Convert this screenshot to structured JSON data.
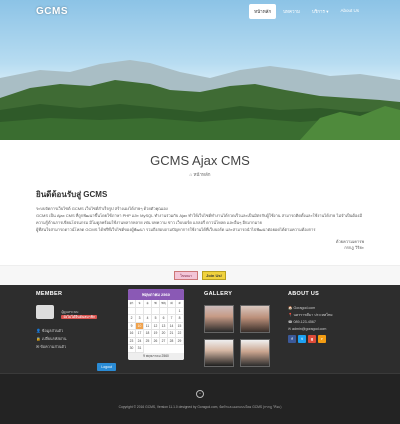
{
  "header": {
    "logo": "GCMS",
    "nav": [
      {
        "label": "หน้าหลัก",
        "active": true
      },
      {
        "label": "บทความ",
        "active": false
      },
      {
        "label": "บริการ ▾",
        "active": false
      },
      {
        "label": "About Us",
        "active": false
      }
    ]
  },
  "title_band": {
    "title": "GCMS Ajax CMS",
    "breadcrumb": "⌂ หน้าหลัก"
  },
  "content": {
    "heading": "ยินดีต้อนรับสู่ GCMS",
    "p1": "ระบบจัดการเว็บไซต์ GCMS เว็บไซต์สำเร็จรูป สร้างเองได้ง่ายๆ ด้วยตัวคุณเอง",
    "p2": "GCMS เป็น Ajax CMS ที่ถูกพัฒนาขึ้นโดยใช้ภาษา PHP และ MySQL ทำงานร่วมกับ Ajax ทำให้เว็บไซต์ทำงานได้รวดเร็วและเป็นมิตรกับผู้ใช้งาน สามารถติดตั้งและใช้งานได้ง่าย ไม่จำเป็นต้องมีความรู้ด้านการเขียนโปรแกรม มีโมดูลพร้อมใช้งานหลากหลาย เช่น บทความ ข่าว เว็บบอร์ด แกลอรี่ ดาวน์โหลด และอื่นๆ อีกมากมาย",
    "p3": "ผู้ที่สนใจสามารถดาวน์โหลด GCMS ได้ฟรีที่เว็บไซต์ของผู้พัฒนา รวมถึงสอบถามปัญหาการใช้งานได้ที่เว็บบอร์ด และสามารถนำไปพัฒนาต่อยอดได้ตามความต้องการ",
    "signature_line1": "ด้วยความเคารพ",
    "signature_line2": "กรกฎ วิริยะ"
  },
  "ads": {
    "ad1": "โฆษณา",
    "ad2": "Join Us!"
  },
  "footer": {
    "member": {
      "title": "MEMBER",
      "name": "ผู้ดูแลระบบ",
      "status": "ยังไม่ได้ยืนยันสมาชิก",
      "links": [
        "ข้อมูลส่วนตัว",
        "เปลี่ยนรหัสผ่าน",
        "ข้อความส่วนตัว"
      ],
      "logout": "Logout"
    },
    "calendar": {
      "title": "พฤษภาคม 2560",
      "weekdays": [
        "อา",
        "จ",
        "อ",
        "พ",
        "พฤ",
        "ศ",
        "ส"
      ],
      "cells": [
        "",
        "",
        "",
        "",
        "",
        "",
        "1",
        "2",
        "3",
        "4",
        "5",
        "6",
        "7",
        "8",
        "9",
        "10",
        "11",
        "12",
        "13",
        "14",
        "15",
        "16",
        "17",
        "18",
        "19",
        "20",
        "21",
        "22",
        "23",
        "24",
        "25",
        "26",
        "27",
        "28",
        "29",
        "30",
        "31"
      ],
      "today": "10",
      "footer": "9 พฤษภาคม 2560"
    },
    "gallery": {
      "title": "GALLERY"
    },
    "about": {
      "title": "ABOUT US",
      "lines": [
        "🏠 Goragod.com",
        "📍 นครราชสีมา ประเทศไทย",
        "☎ 089-123-4567",
        "✉ admin@goragod.com"
      ],
      "socials": [
        {
          "icon": "f",
          "color": "#3b5998"
        },
        {
          "icon": "t",
          "color": "#1da1f2"
        },
        {
          "icon": "g",
          "color": "#dd4b39"
        },
        {
          "icon": "r",
          "color": "#f39c12"
        }
      ]
    },
    "totop": "^",
    "copyright": "Copyright © 2016 GCMS, Version 11.1.0 designed by Goragod.com, จัดทำและออกแบบโดย GCMS (กรกฎ วิริยะ)"
  }
}
